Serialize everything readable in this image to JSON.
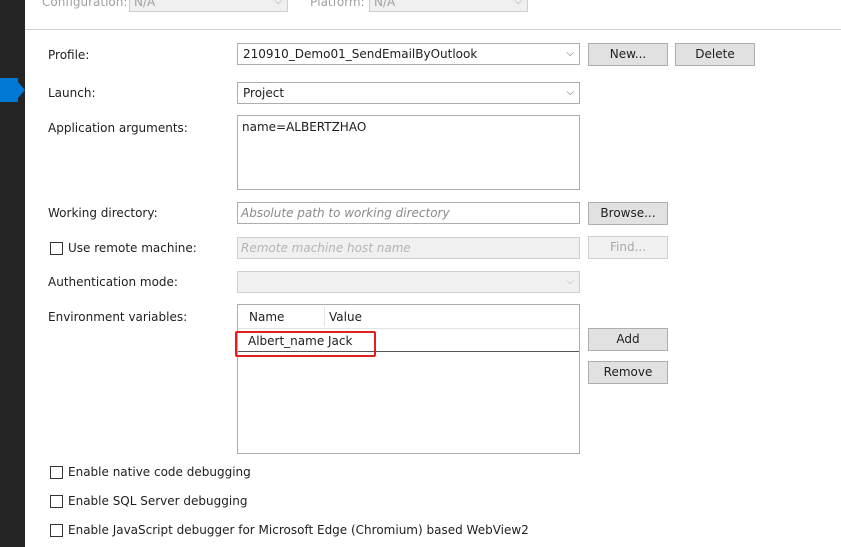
{
  "top": {
    "configuration_label": "Configuration:",
    "configuration_value": "N/A",
    "platform_label": "Platform:",
    "platform_value": "N/A"
  },
  "profile": {
    "label": "Profile:",
    "value": "210910_Demo01_SendEmailByOutlook",
    "new_label": "New...",
    "delete_label": "Delete"
  },
  "launch": {
    "label": "Launch:",
    "value": "Project"
  },
  "app_args": {
    "label": "Application arguments:",
    "value": "name=ALBERTZHAO"
  },
  "working_dir": {
    "label": "Working directory:",
    "placeholder": "Absolute path to working directory",
    "browse_label": "Browse..."
  },
  "remote": {
    "label": "Use remote machine:",
    "checked": false,
    "placeholder": "Remote machine host name",
    "find_label": "Find..."
  },
  "auth": {
    "label": "Authentication mode:",
    "value": ""
  },
  "env": {
    "label": "Environment variables:",
    "columns": [
      "Name",
      "Value"
    ],
    "rows": [
      {
        "name": "Albert_name",
        "value": "Jack"
      }
    ],
    "add_label": "Add",
    "remove_label": "Remove"
  },
  "options": [
    {
      "label": "Enable native code debugging",
      "checked": false
    },
    {
      "label": "Enable SQL Server debugging",
      "checked": false
    },
    {
      "label": "Enable JavaScript debugger for Microsoft Edge (Chromium) based WebView2",
      "checked": false
    }
  ],
  "colors": {
    "highlight": "#e02020",
    "sidebar": "#252526",
    "accent": "#0078d4"
  }
}
